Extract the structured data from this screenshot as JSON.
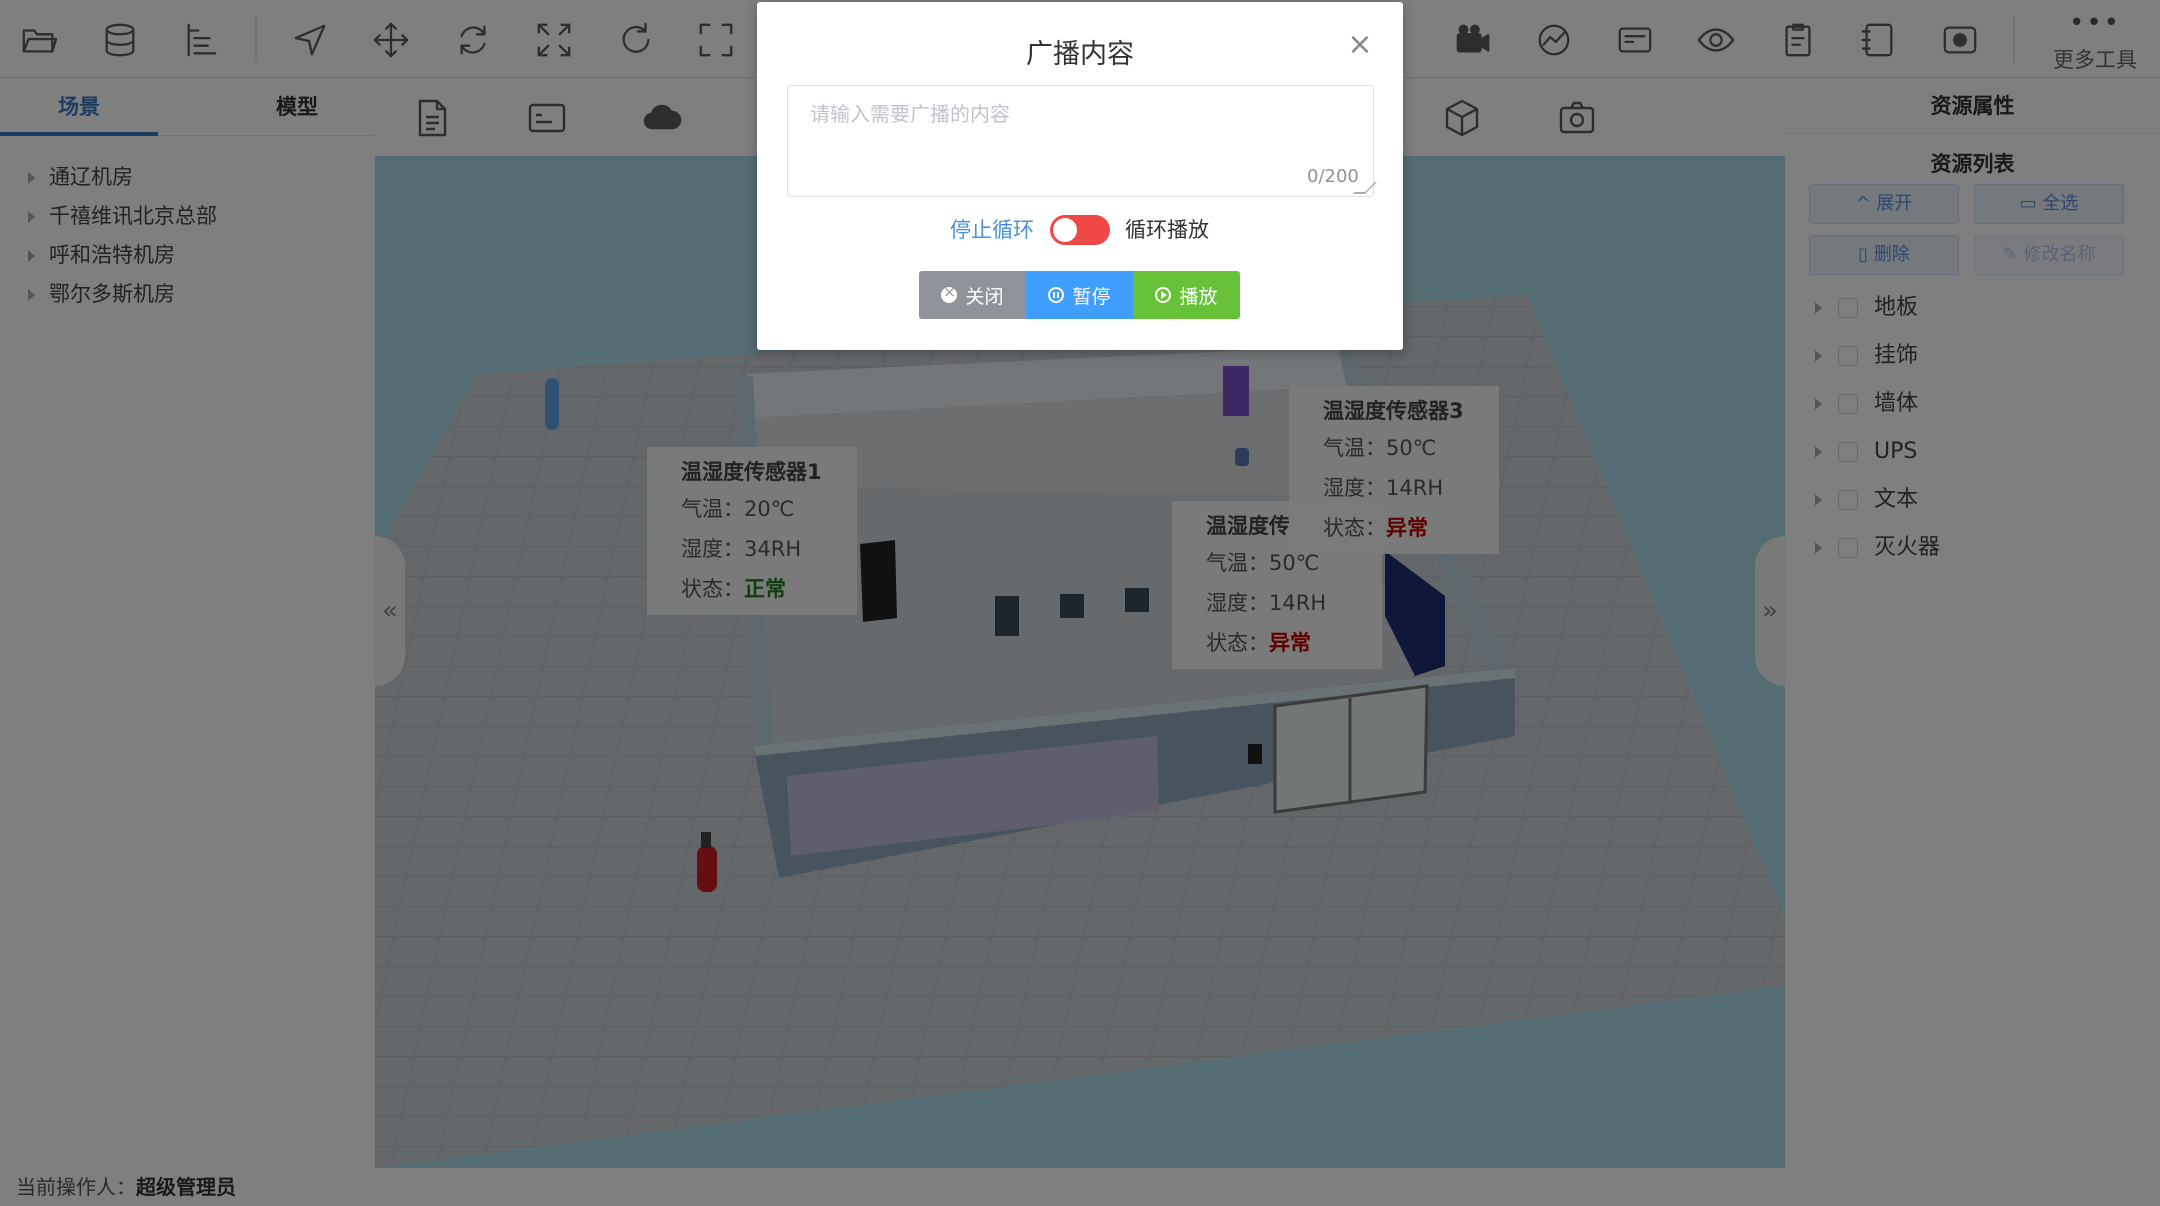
{
  "toolbar": {
    "icons": [
      "folder-open-icon",
      "database-icon",
      "tree-list-icon",
      "navigate-arrow-icon",
      "move-icon",
      "rotate-icon",
      "expand-arrows-icon",
      "refresh-icon",
      "fullscreen-icon",
      "video-camera-icon",
      "dashboard-icon",
      "card-icon",
      "eye-icon",
      "clipboard-icon",
      "notebook-icon",
      "record-icon"
    ],
    "more_tools_label": "更多工具"
  },
  "left_panel": {
    "tabs": [
      {
        "label": "场景",
        "active": true
      },
      {
        "label": "模型",
        "active": false
      }
    ],
    "tree": [
      {
        "label": "通辽机房"
      },
      {
        "label": "千禧维讯北京总部"
      },
      {
        "label": "呼和浩特机房"
      },
      {
        "label": "鄂尔多斯机房"
      }
    ]
  },
  "sub_toolbar": {
    "icons": [
      "document-icon",
      "terminal-card-icon",
      "cloud-icon",
      "cube-icon",
      "camera-icon"
    ]
  },
  "viewport": {
    "collapse_left_label": "«",
    "collapse_right_label": "»",
    "sensors": [
      {
        "title": "温湿度传感器1",
        "temp_label": "气温：",
        "temp_value": "20℃",
        "humidity_label": "湿度：",
        "humidity_value": "34RH",
        "status_label": "状态：",
        "status_value": "正常",
        "status_color": "#1e7d1e"
      },
      {
        "title": "温湿度传",
        "temp_label": "气温：",
        "temp_value": "50℃",
        "humidity_label": "湿度：",
        "humidity_value": "14RH",
        "status_label": "状态：",
        "status_value": "异常",
        "status_color": "#c00000"
      },
      {
        "title": "温湿度传感器3",
        "temp_label": "气温：",
        "temp_value": "50℃",
        "humidity_label": "湿度：",
        "humidity_value": "14RH",
        "status_label": "状态：",
        "status_value": "异常",
        "status_color": "#c00000"
      }
    ]
  },
  "right_panel": {
    "title": "资源属性",
    "list_title": "资源列表",
    "buttons": [
      {
        "label": "展开",
        "icon": "chevron-up-icon",
        "enabled": true
      },
      {
        "label": "全选",
        "icon": "folder-icon",
        "enabled": true
      },
      {
        "label": "删除",
        "icon": "trash-icon",
        "enabled": true
      },
      {
        "label": "修改名称",
        "icon": "edit-icon",
        "enabled": false
      }
    ],
    "resources": [
      {
        "label": "地板"
      },
      {
        "label": "挂饰"
      },
      {
        "label": "墙体"
      },
      {
        "label": "UPS"
      },
      {
        "label": "文本"
      },
      {
        "label": "灭火器"
      }
    ]
  },
  "status_bar": {
    "operator_label": "当前操作人：",
    "operator_name": "超级管理员"
  },
  "dialog": {
    "title": "广播内容",
    "close_symbol": "×",
    "textarea_placeholder": "请输入需要广播的内容",
    "textarea_value": "",
    "char_count": "0/200",
    "stop_loop_label": "停止循环",
    "loop_switch_on": false,
    "loop_play_label": "循环播放",
    "btn_close": "关闭",
    "btn_pause": "暂停",
    "btn_play": "播放",
    "colors": {
      "close": "#909399",
      "pause": "#409eff",
      "play": "#67c23a",
      "switch": "#f04747"
    }
  }
}
